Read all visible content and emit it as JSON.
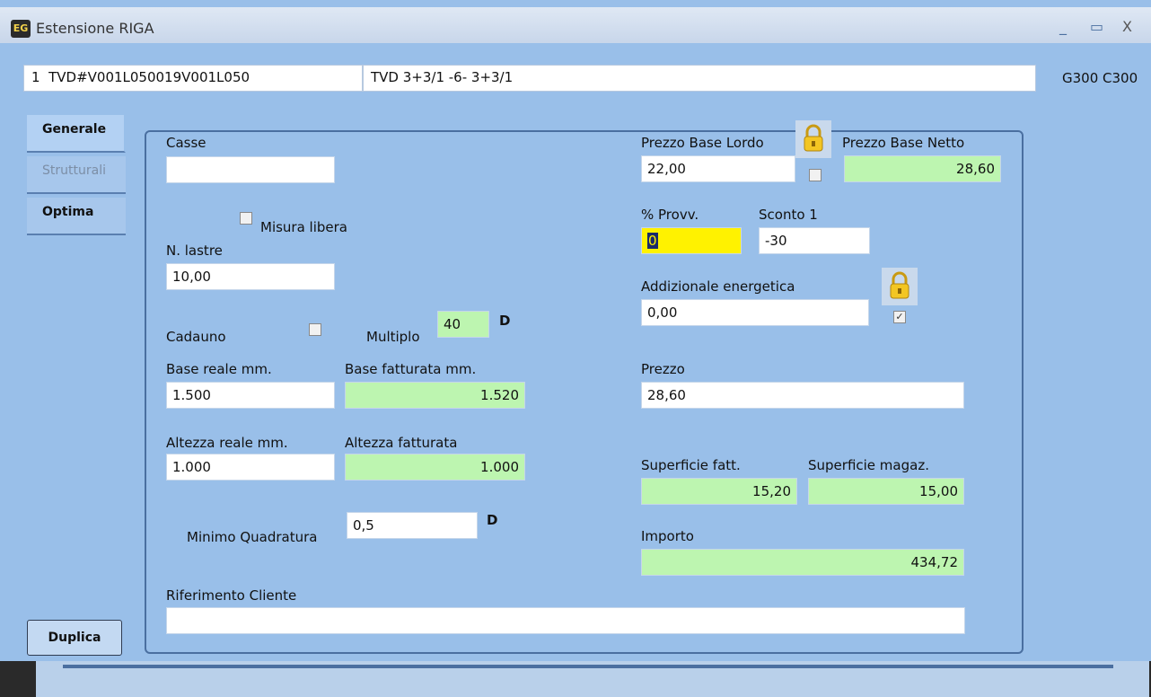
{
  "window": {
    "title": "Estensione RIGA",
    "app_icon": "app-icon",
    "minimize": "_",
    "maximize": "▭",
    "close": "X"
  },
  "header": {
    "row_num": "1",
    "code": "TVD#V001L050019V001L050",
    "description": "TVD 3+3/1   -6-  3+3/1",
    "codes": "G300 C300"
  },
  "tabs": [
    {
      "label": "Generale"
    },
    {
      "label": "Strutturali"
    },
    {
      "label": "Optima"
    }
  ],
  "form": {
    "casse_label": "Casse",
    "casse_value": "",
    "misura_libera_label": "Misura libera",
    "n_lastre_label": "N. lastre",
    "n_lastre_value": "10,00",
    "cadauno_label": "Cadauno",
    "multiplo_label": "Multiplo",
    "multiplo_value": "40",
    "d_marker": "D",
    "base_reale_label": "Base reale mm.",
    "base_reale_value": "1.500",
    "base_fatturata_label": "Base fatturata mm.",
    "base_fatturata_value": "1.520",
    "altezza_reale_label": "Altezza reale mm.",
    "altezza_reale_value": "1.000",
    "altezza_fatturata_label": "Altezza fatturata",
    "altezza_fatturata_value": "1.000",
    "minimo_quadratura_label": "Minimo Quadratura",
    "minimo_quadratura_value": "0,5",
    "riferimento_cliente_label": "Riferimento Cliente",
    "riferimento_cliente_value": "",
    "prezzo_base_lordo_label": "Prezzo Base Lordo",
    "prezzo_base_lordo_value": "22,00",
    "prezzo_base_netto_label": "Prezzo Base Netto",
    "prezzo_base_netto_value": "28,60",
    "provv_label": "% Provv.",
    "provv_value": "0",
    "sconto1_label": "Sconto 1",
    "sconto1_value": "-30",
    "addizionale_label": "Addizionale energetica",
    "addizionale_value": "0,00",
    "prezzo_label": "Prezzo",
    "prezzo_value": "28,60",
    "superficie_fatt_label": "Superficie fatt.",
    "superficie_fatt_value": "15,20",
    "superficie_magaz_label": "Superficie magaz.",
    "superficie_magaz_value": "15,00",
    "importo_label": "Importo",
    "importo_value": "434,72"
  },
  "buttons": {
    "duplica": "Duplica"
  },
  "checkbox_state": {
    "misura_libera": false,
    "cadauno": false,
    "lordo_lock": false,
    "addizionale_lock": true
  },
  "colors": {
    "window_bg": "#99bfe9",
    "computed_field": "#bdf5b0",
    "focus_field": "#fff200",
    "lock": "#f3c623"
  }
}
